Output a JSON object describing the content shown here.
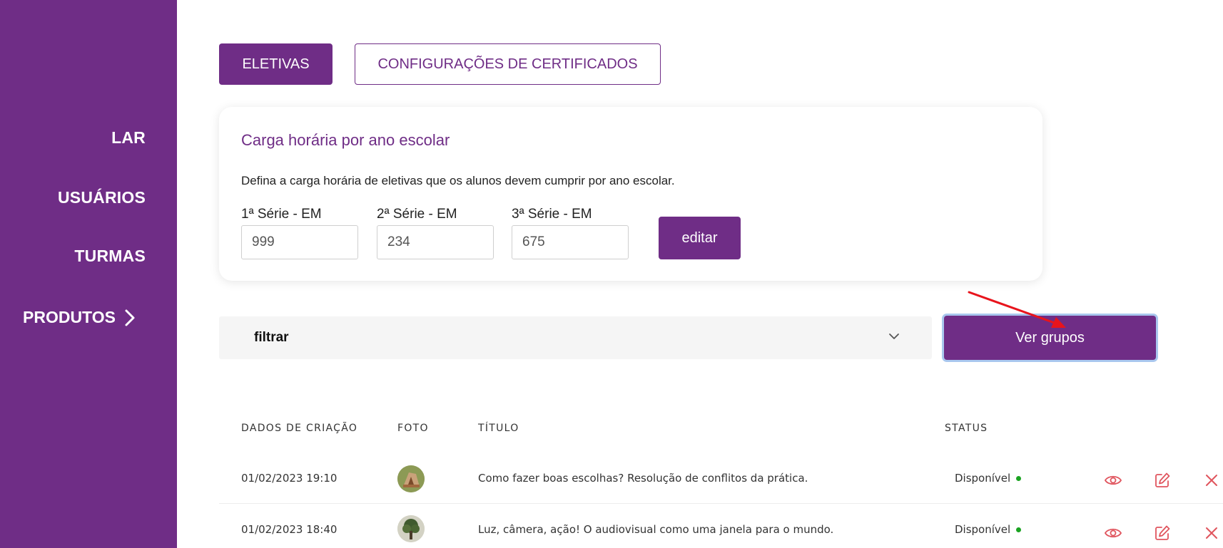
{
  "sidebar": {
    "items": [
      {
        "label": "LAR"
      },
      {
        "label": "USUÁRIOS"
      },
      {
        "label": "TURMAS"
      },
      {
        "label": "PRODUTOS"
      }
    ]
  },
  "tabs": [
    {
      "label": "ELETIVAS",
      "active": true
    },
    {
      "label": "CONFIGURAÇÕES DE CERTIFICADOS",
      "active": false
    }
  ],
  "workload_card": {
    "title": "Carga horária por ano escolar",
    "description": "Defina a carga horária de eletivas que os alunos devem cumprir por ano escolar.",
    "fields": [
      {
        "label": "1ª Série - EM",
        "value": "999"
      },
      {
        "label": "2ª Série - EM",
        "value": "234"
      },
      {
        "label": "3ª Série - EM",
        "value": "675"
      }
    ],
    "edit_label": "editar"
  },
  "filter": {
    "label": "filtrar"
  },
  "ver_grupos_label": "Ver grupos",
  "table": {
    "headers": {
      "date": "DADOS DE CRIAÇÃO",
      "photo": "FOTO",
      "title": "TÍTULO",
      "status": "STATUS"
    },
    "rows": [
      {
        "date": "01/02/2023 19:10",
        "title": "Como fazer boas escolhas? Resolução de conflitos da prática.",
        "status": "Disponível"
      },
      {
        "date": "01/02/2023 18:40",
        "title": "Luz, câmera, ação! O audiovisual como uma janela para o mundo.",
        "status": "Disponível"
      }
    ]
  },
  "colors": {
    "brand": "#6f2d86",
    "status_available": "#1aa321",
    "action_icons": "#e0555e",
    "annotation_arrow": "#e8141c"
  },
  "icons": [
    "chevron-right-icon",
    "chevron-down-icon",
    "eye-icon",
    "edit-icon",
    "close-icon"
  ]
}
